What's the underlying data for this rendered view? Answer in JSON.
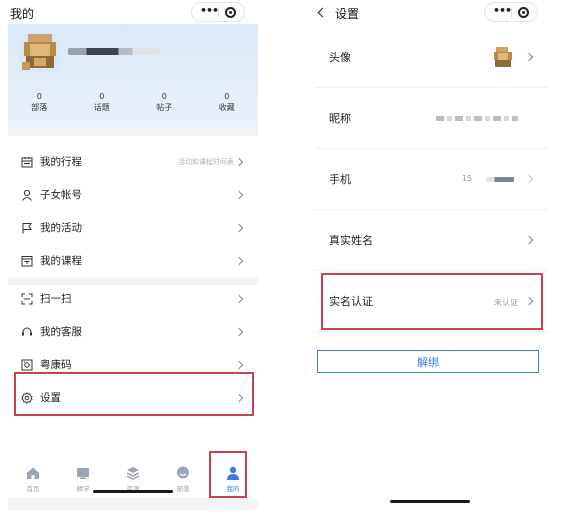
{
  "left": {
    "title": "我的",
    "profile": {
      "stats": [
        {
          "value": "0",
          "label": "部落"
        },
        {
          "value": "0",
          "label": "话题"
        },
        {
          "value": "0",
          "label": "帖子"
        },
        {
          "value": "0",
          "label": "收藏"
        }
      ]
    },
    "menu_group1": [
      {
        "label": "我的行程",
        "right": "活动和课程时间表",
        "icon": "calendar-icon"
      },
      {
        "label": "子女帐号",
        "right": "",
        "icon": "person-icon"
      },
      {
        "label": "我的活动",
        "right": "",
        "icon": "flag-icon"
      },
      {
        "label": "我的课程",
        "right": "",
        "icon": "course-icon"
      }
    ],
    "menu_group2": [
      {
        "label": "扫一扫",
        "icon": "scan-icon"
      },
      {
        "label": "我的客服",
        "icon": "headset-icon"
      },
      {
        "label": "粤康码",
        "icon": "health-code-icon"
      },
      {
        "label": "设置",
        "icon": "gear-icon"
      }
    ],
    "tabbar": [
      {
        "label": "首页",
        "icon": "home-icon",
        "active": false
      },
      {
        "label": "精学",
        "icon": "study-icon",
        "active": false
      },
      {
        "label": "资源",
        "icon": "layers-icon",
        "active": false
      },
      {
        "label": "部落",
        "icon": "chat-icon",
        "active": false
      },
      {
        "label": "我的",
        "icon": "user-icon",
        "active": true
      }
    ]
  },
  "right": {
    "title": "设置",
    "rows": [
      {
        "label": "头像"
      },
      {
        "label": "昵称"
      },
      {
        "label": "手机",
        "value_prefix": "15"
      },
      {
        "label": "真实姓名"
      },
      {
        "label": "实名认证",
        "value": "未认证"
      }
    ],
    "unbind_label": "解绑"
  },
  "colors": {
    "accent": "#3b7fe3",
    "highlight": "#c8424f",
    "profile_bg": "#dbe8f6"
  }
}
